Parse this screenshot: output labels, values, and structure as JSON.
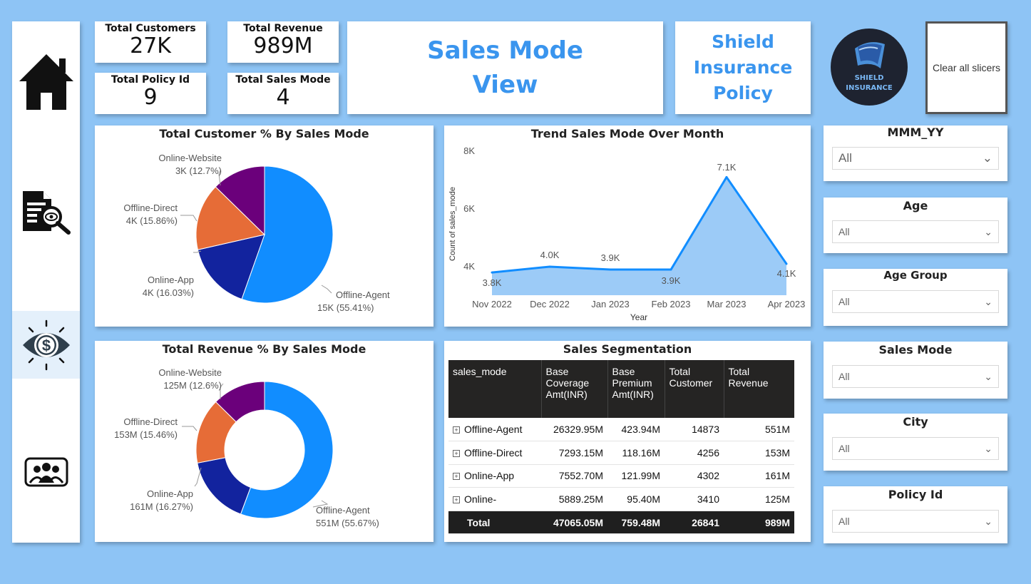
{
  "kpis": [
    {
      "label": "Total Customers",
      "value": "27K"
    },
    {
      "label": "Total Revenue",
      "value": "989M"
    },
    {
      "label": "Total Policy Id",
      "value": "9"
    },
    {
      "label": "Total Sales Mode",
      "value": "4"
    }
  ],
  "header": {
    "page_title_line1": "Sales Mode",
    "page_title_line2": "View",
    "brand_line1": "Shield",
    "brand_line2": "Insurance",
    "brand_line3": "Policy",
    "logo_line1": "SHIELD",
    "logo_line2": "INSURANCE",
    "clear_button": "Clear all slicers"
  },
  "nav": {
    "icons": [
      "home-icon",
      "document-search-icon",
      "dollar-eye-icon",
      "customers-icon"
    ],
    "active_index": 2
  },
  "customer_pie": {
    "title": "Total Customer % By Sales Mode",
    "labels": [
      {
        "name": "Offline-Agent",
        "detail": "15K (55.41%)"
      },
      {
        "name": "Online-App",
        "detail": "4K (16.03%)"
      },
      {
        "name": "Offline-Direct",
        "detail": "4K (15.86%)"
      },
      {
        "name": "Online-Website",
        "detail": "3K (12.7%)"
      }
    ]
  },
  "revenue_donut": {
    "title": "Total Revenue % By Sales Mode",
    "labels": [
      {
        "name": "Offline-Agent",
        "detail": "551M (55.67%)"
      },
      {
        "name": "Online-App",
        "detail": "161M (16.27%)"
      },
      {
        "name": "Offline-Direct",
        "detail": "153M (15.46%)"
      },
      {
        "name": "Online-Website",
        "detail": "125M (12.6%)"
      }
    ]
  },
  "trend": {
    "title": "Trend Sales Mode Over Month",
    "y_ticks": [
      "8K",
      "6K",
      "4K"
    ],
    "point_labels": [
      "3.8K",
      "4.0K",
      "3.9K",
      "3.9K",
      "7.1K",
      "4.1K"
    ],
    "xlabel": "Year",
    "ylabel": "Count of sales_mode"
  },
  "table": {
    "title": "Sales Segmentation",
    "headers": [
      "sales_mode",
      "Base Coverage Amt(INR)",
      "Base Premium Amt(INR)",
      "Total Customer",
      "Total Revenue"
    ],
    "rows": [
      [
        "Offline-Agent",
        "26329.95M",
        "423.94M",
        "14873",
        "551M"
      ],
      [
        "Offline-Direct",
        "7293.15M",
        "118.16M",
        "4256",
        "153M"
      ],
      [
        "Online-App",
        "7552.70M",
        "121.99M",
        "4302",
        "161M"
      ],
      [
        "Online-",
        "5889.25M",
        "95.40M",
        "3410",
        "125M"
      ]
    ],
    "total": [
      "Total",
      "47065.05M",
      "759.48M",
      "26841",
      "989M"
    ]
  },
  "slicers": [
    {
      "title": "MMM_YY",
      "value": "All"
    },
    {
      "title": "Age",
      "value": "All"
    },
    {
      "title": "Age Group",
      "value": "All"
    },
    {
      "title": "Sales Mode",
      "value": "All"
    },
    {
      "title": "City",
      "value": "All"
    },
    {
      "title": "Policy Id",
      "value": "All"
    }
  ],
  "chart_data": [
    {
      "type": "pie",
      "title": "Total Customer % By Sales Mode",
      "categories": [
        "Offline-Agent",
        "Online-App",
        "Offline-Direct",
        "Online-Website"
      ],
      "values": [
        55.41,
        16.03,
        15.86,
        12.7
      ],
      "display_values": [
        "15K",
        "4K",
        "4K",
        "3K"
      ],
      "colors": [
        "#118dff",
        "#12239e",
        "#e66c37",
        "#6b007b"
      ]
    },
    {
      "type": "pie",
      "title": "Total Revenue % By Sales Mode",
      "categories": [
        "Offline-Agent",
        "Online-App",
        "Offline-Direct",
        "Online-Website"
      ],
      "values": [
        55.67,
        16.27,
        15.46,
        12.6
      ],
      "display_values": [
        "551M",
        "161M",
        "153M",
        "125M"
      ],
      "colors": [
        "#118dff",
        "#12239e",
        "#e66c37",
        "#6b007b"
      ]
    },
    {
      "type": "area",
      "title": "Trend Sales Mode Over Month",
      "categories": [
        "Nov 2022",
        "Dec 2022",
        "Jan 2023",
        "Feb 2023",
        "Mar 2023",
        "Apr 2023"
      ],
      "series": [
        {
          "values": [
            3800,
            4000,
            3900,
            3900,
            7100,
            4100
          ]
        }
      ],
      "xlabel": "Year",
      "ylabel": "Count of sales_mode",
      "ylim": [
        3000,
        8000
      ],
      "color": "#118dff"
    }
  ]
}
